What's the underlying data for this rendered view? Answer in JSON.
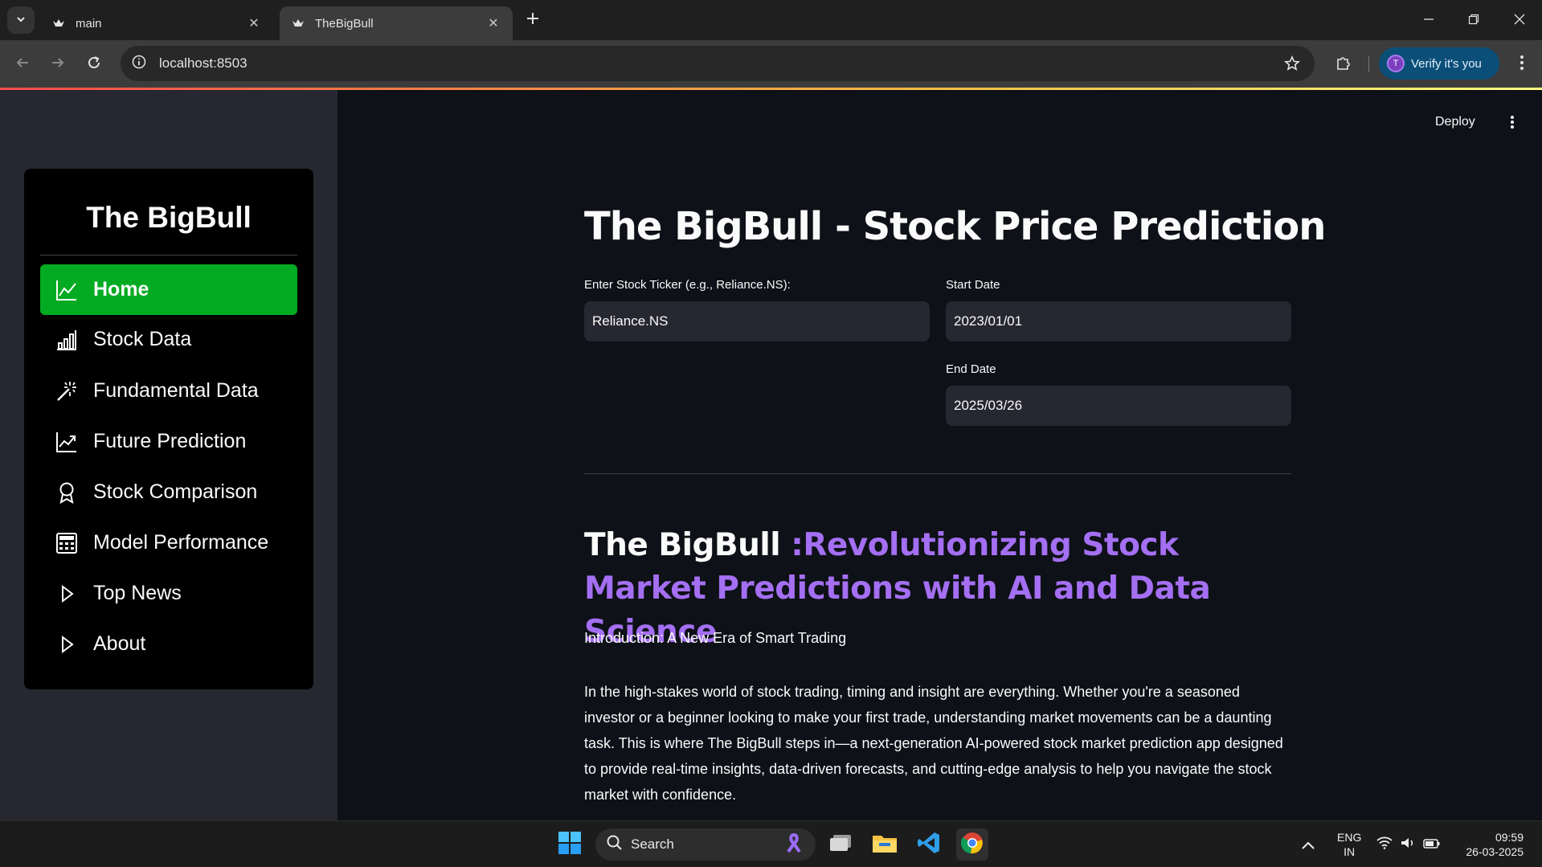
{
  "browser": {
    "tabs": [
      {
        "title": "main",
        "active": false
      },
      {
        "title": "TheBigBull",
        "active": true
      }
    ],
    "url": "localhost:8503",
    "verify_label": "Verify it's you",
    "profile_initial": "T"
  },
  "colors": {
    "accent_green": "#02ab21",
    "heading_purple": "#a46ff2",
    "background": "#0e1117",
    "sidebar": "#262730"
  },
  "sidebar": {
    "title": "The BigBull",
    "items": [
      {
        "label": "Home",
        "icon": "line-chart-icon",
        "active": true
      },
      {
        "label": "Stock Data",
        "icon": "bar-chart-icon",
        "active": false
      },
      {
        "label": "Fundamental Data",
        "icon": "magic-wand-icon",
        "active": false
      },
      {
        "label": "Future Prediction",
        "icon": "graph-up-icon",
        "active": false
      },
      {
        "label": "Stock Comparison",
        "icon": "award-icon",
        "active": false
      },
      {
        "label": "Model Performance",
        "icon": "calculator-icon",
        "active": false
      },
      {
        "label": "Top News",
        "icon": "play-icon",
        "active": false
      },
      {
        "label": "About",
        "icon": "play-icon",
        "active": false
      }
    ]
  },
  "header": {
    "deploy_label": "Deploy"
  },
  "main": {
    "title": "The BigBull - Stock Price Prediction",
    "ticker_label": "Enter Stock Ticker (e.g., Reliance.NS):",
    "ticker_value": "Reliance.NS",
    "start_label": "Start Date",
    "start_value": "2023/01/01",
    "end_label": "End Date",
    "end_value": "2025/03/26",
    "subtitle_white": "The BigBull ",
    "subtitle_purple": ":Revolutionizing Stock Market Predictions with AI and Data Science",
    "intro": "Introduction: A New Era of Smart Trading",
    "paragraph": "In the high-stakes world of stock trading, timing and insight are everything. Whether you're a seasoned investor or a beginner looking to make your first trade, understanding market movements can be a daunting task. This is where The BigBull steps in—a next-generation AI-powered stock market prediction app designed to provide real-time insights, data-driven forecasts, and cutting-edge analysis to help you navigate the stock market with confidence."
  },
  "taskbar": {
    "search_label": "Search",
    "language": "ENG",
    "region": "IN",
    "time": "09:59",
    "date": "26-03-2025"
  }
}
